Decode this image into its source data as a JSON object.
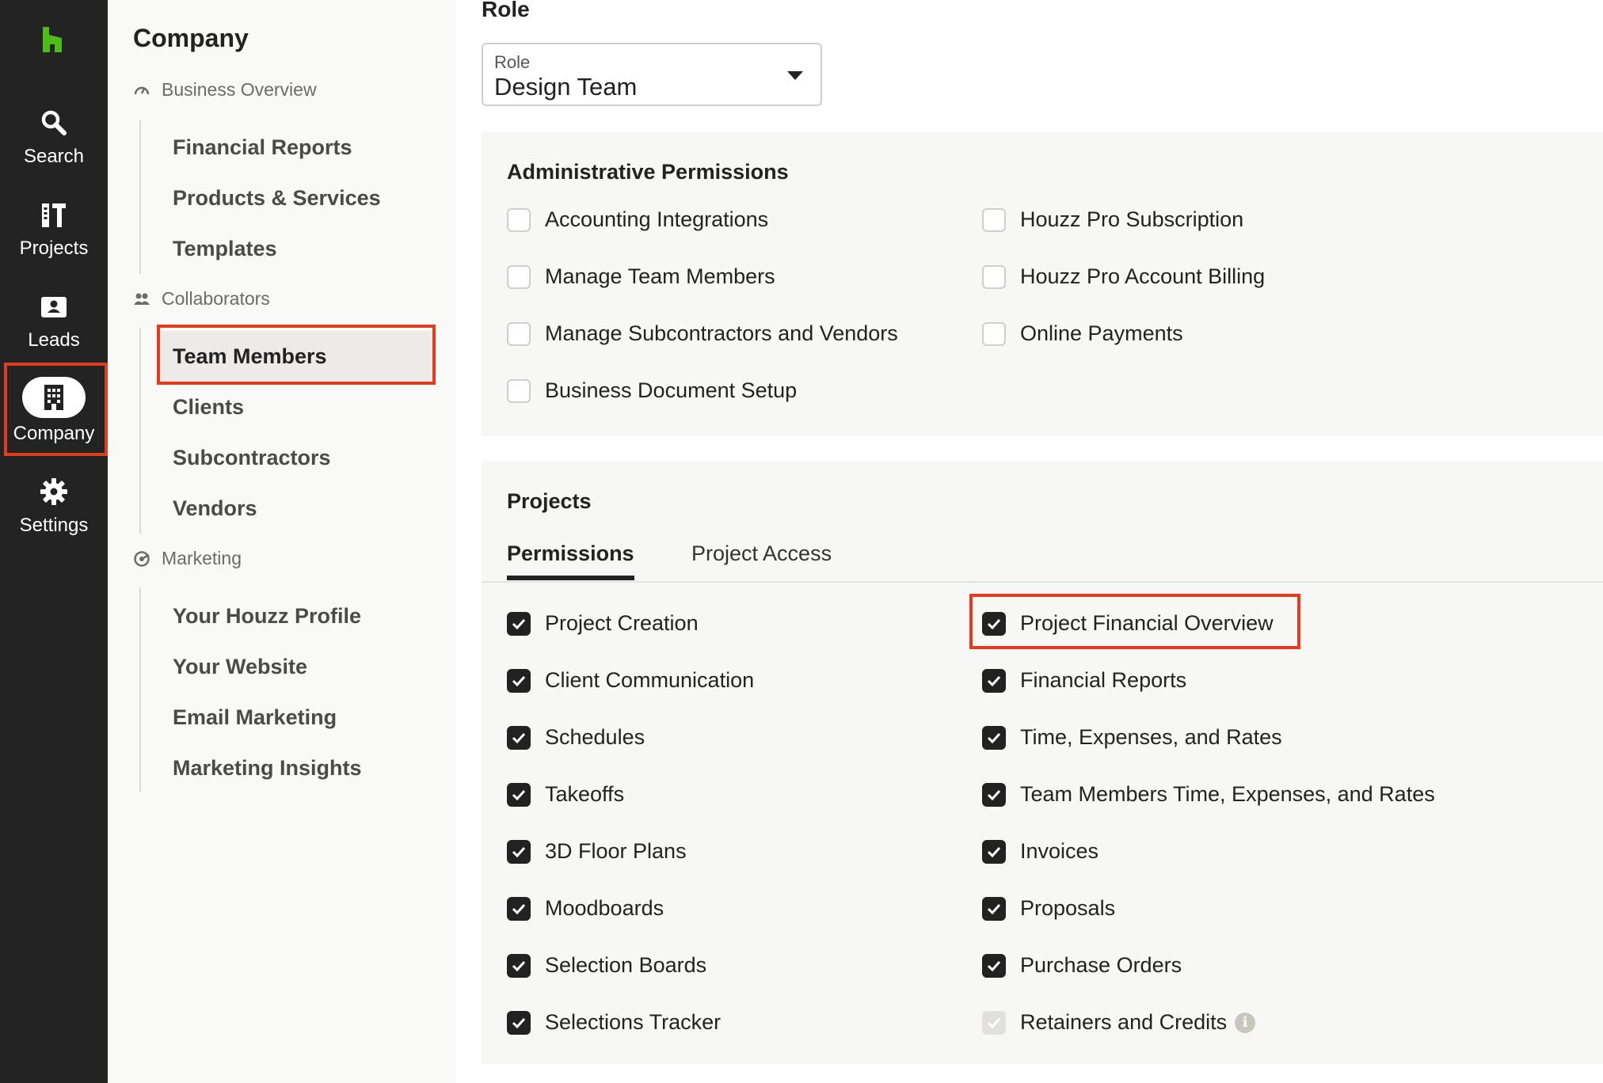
{
  "rail": {
    "items": [
      {
        "label": "Search",
        "icon": "search-icon"
      },
      {
        "label": "Projects",
        "icon": "projects-icon"
      },
      {
        "label": "Leads",
        "icon": "leads-icon"
      },
      {
        "label": "Company",
        "icon": "building-icon"
      },
      {
        "label": "Settings",
        "icon": "gear-icon"
      }
    ],
    "active": "Company"
  },
  "sidebar": {
    "title": "Company",
    "groups": [
      {
        "label": "Business Overview",
        "icon": "gauge-icon",
        "items": [
          "Financial Reports",
          "Products & Services",
          "Templates"
        ]
      },
      {
        "label": "Collaborators",
        "icon": "people-icon",
        "items": [
          "Team Members",
          "Clients",
          "Subcontractors",
          "Vendors"
        ]
      },
      {
        "label": "Marketing",
        "icon": "marketing-icon",
        "items": [
          "Your Houzz Profile",
          "Your Website",
          "Email Marketing",
          "Marketing Insights"
        ]
      }
    ],
    "selected": "Team Members"
  },
  "main": {
    "heading": "Role",
    "role_select": {
      "label": "Role",
      "value": "Design Team"
    },
    "admin": {
      "title": "Administrative Permissions",
      "left": [
        {
          "label": "Accounting Integrations",
          "checked": false
        },
        {
          "label": "Manage Team Members",
          "checked": false
        },
        {
          "label": "Manage Subcontractors and Vendors",
          "checked": false
        },
        {
          "label": "Business Document Setup",
          "checked": false
        }
      ],
      "right": [
        {
          "label": "Houzz Pro Subscription",
          "checked": false
        },
        {
          "label": "Houzz Pro Account Billing",
          "checked": false
        },
        {
          "label": "Online Payments",
          "checked": false
        }
      ]
    },
    "projects": {
      "title": "Projects",
      "tabs": [
        "Permissions",
        "Project Access"
      ],
      "active_tab": "Permissions",
      "left": [
        {
          "label": "Project Creation",
          "checked": true
        },
        {
          "label": "Client Communication",
          "checked": true
        },
        {
          "label": "Schedules",
          "checked": true
        },
        {
          "label": "Takeoffs",
          "checked": true
        },
        {
          "label": "3D Floor Plans",
          "checked": true
        },
        {
          "label": "Moodboards",
          "checked": true
        },
        {
          "label": "Selection Boards",
          "checked": true
        },
        {
          "label": "Selections Tracker",
          "checked": true
        }
      ],
      "right": [
        {
          "label": "Project Financial Overview",
          "checked": true
        },
        {
          "label": "Financial Reports",
          "checked": true
        },
        {
          "label": "Time, Expenses, and Rates",
          "checked": true
        },
        {
          "label": "Team Members Time, Expenses, and Rates",
          "checked": true
        },
        {
          "label": "Invoices",
          "checked": true
        },
        {
          "label": "Proposals",
          "checked": true
        },
        {
          "label": "Purchase Orders",
          "checked": true
        },
        {
          "label": "Retainers and Credits",
          "checked": true,
          "disabled": true,
          "info_icon": "info-icon"
        }
      ]
    }
  },
  "colors": {
    "rail_bg": "#232323",
    "brand_green": "#4dbc15",
    "highlight_red": "#e23b1d",
    "checkbox_checked": "#222222"
  }
}
